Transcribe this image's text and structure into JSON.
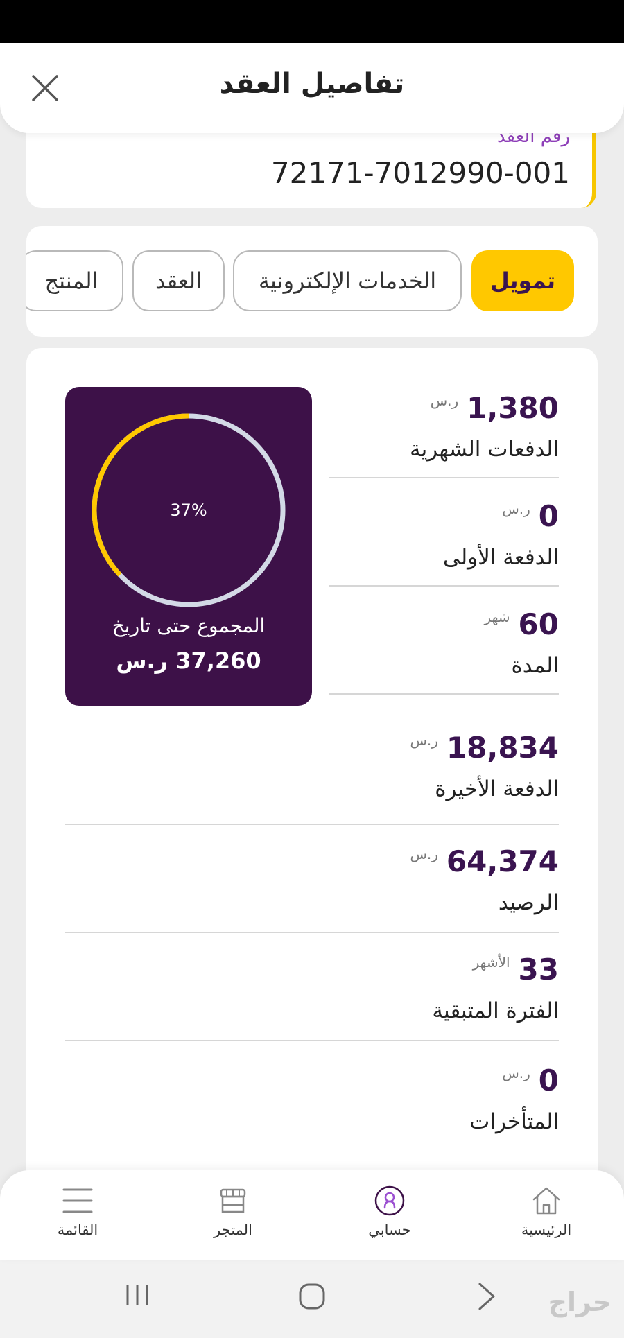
{
  "header": {
    "title": "تفاصيل العقد",
    "close_icon": "close-icon"
  },
  "contract": {
    "label": "رقم العقد",
    "number": "72171-7012990-001"
  },
  "tabs": [
    {
      "label": "تمويل",
      "active": true
    },
    {
      "label": "الخدمات الإلكترونية",
      "active": false
    },
    {
      "label": "العقد",
      "active": false
    },
    {
      "label": "المنتج",
      "active": false
    }
  ],
  "summary": {
    "percent_label": "37%",
    "percent_value": 0.37,
    "label": "المجموع حتى تاريخ",
    "value": "37,260 ر.س"
  },
  "stats": [
    {
      "value": "1,380",
      "unit": "ر.س",
      "label": "الدفعات الشهرية"
    },
    {
      "value": "0",
      "unit": "ر.س",
      "label": "الدفعة الأولى"
    },
    {
      "value": "60",
      "unit": "شهر",
      "label": "المدة"
    },
    {
      "value": "18,834",
      "unit": "ر.س",
      "label": "الدفعة الأخيرة"
    },
    {
      "value": "64,374",
      "unit": "ر.س",
      "label": "الرصيد"
    },
    {
      "value": "33",
      "unit": "الأشهر",
      "label": "الفترة المتبقية"
    },
    {
      "value": "0",
      "unit": "ر.س",
      "label": "المتأخرات"
    }
  ],
  "bottom_nav": [
    {
      "label": "الرئيسية",
      "icon": "home-icon"
    },
    {
      "label": "حسابي",
      "icon": "account-icon"
    },
    {
      "label": "المتجر",
      "icon": "store-icon"
    },
    {
      "label": "القائمة",
      "icon": "menu-icon"
    }
  ],
  "watermark": "حراج",
  "colors": {
    "accent": "#ffc800",
    "brand": "#3d1148",
    "ring_track": "#d3d9e6"
  }
}
